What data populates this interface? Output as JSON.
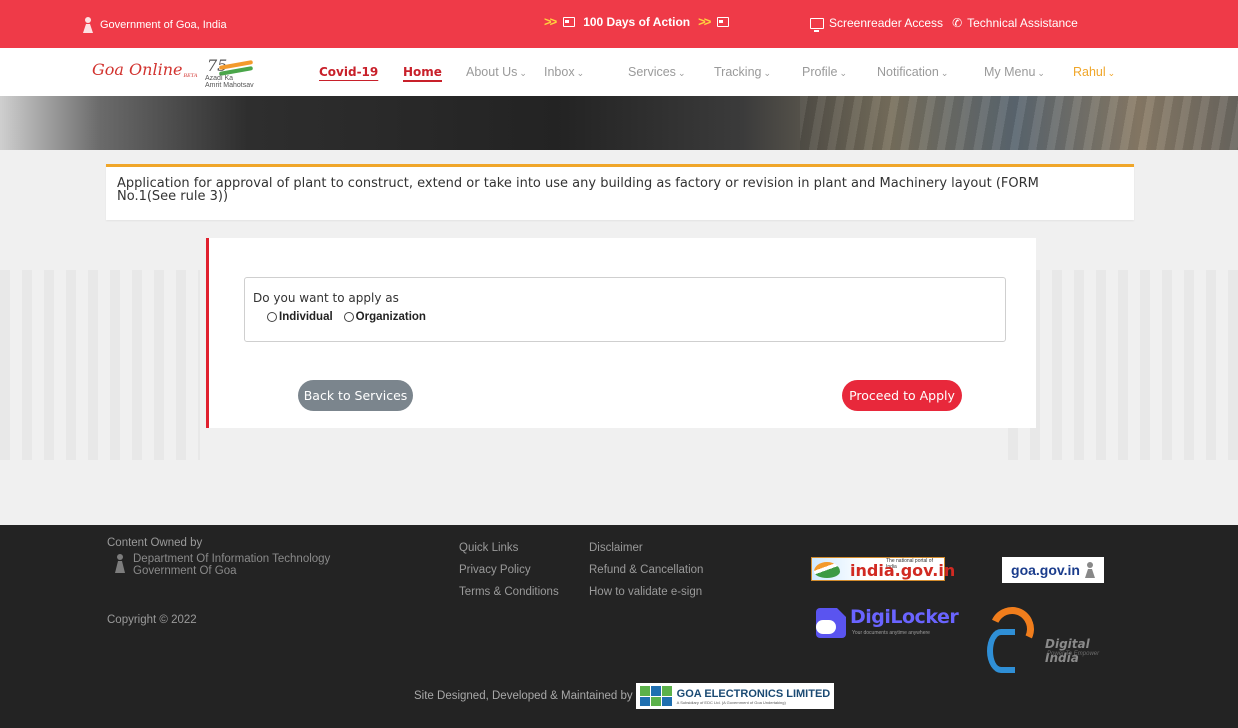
{
  "topbar": {
    "gov_label": "Government of Goa, India",
    "campaign_chevrons": ">>",
    "campaign_label": "100 Days of Action",
    "screenreader_label": "Screenreader Access",
    "tech_label": "Technical Assistance"
  },
  "nav": {
    "brand": "Goa Online",
    "brand_small": "BETA",
    "azadi_top": "Azadi Ka",
    "azadi_bottom": "Amrit Mahotsav",
    "items": [
      {
        "label": "Covid-19"
      },
      {
        "label": "Home"
      },
      {
        "label": "About Us"
      },
      {
        "label": "Inbox"
      },
      {
        "label": "Services"
      },
      {
        "label": "Tracking"
      },
      {
        "label": "Profile"
      },
      {
        "label": "Notification"
      },
      {
        "label": "My Menu"
      },
      {
        "label": "Rahul"
      }
    ]
  },
  "form": {
    "title": "Application for approval of plant to construct, extend or take into use any building as factory or revision in plant and Machinery layout (FORM No.1(See rule 3))",
    "question": "Do you want to apply as",
    "options": [
      "Individual",
      "Organization"
    ],
    "back_label": "Back to Services",
    "proceed_label": "Proceed to Apply"
  },
  "footer": {
    "content_owned": "Content Owned by",
    "dept_line1": "Department Of Information Technology",
    "dept_line2": "Government Of Goa",
    "copyright": "Copyright © 2022",
    "links_col1": [
      "Quick Links",
      "Privacy Policy",
      "Terms & Conditions"
    ],
    "links_col2": [
      "Disclaimer",
      "Refund & Cancellation",
      "How to validate e-sign"
    ],
    "india_gov": "india.gov.in",
    "india_gov_sub": "The national portal of India",
    "goa_gov": "goa.gov.in",
    "digilocker": "DigiLocker",
    "digilocker_tag": "Your documents anytime anywhere",
    "digital_india": "Digital India",
    "digital_india_tag": "Power To Empower",
    "designed_by": "Site Designed, Developed & Maintained by",
    "gel_name": "GOA ELECTRONICS LIMITED",
    "gel_sub": "A Subsidiary of EDC Ltd. (A Government of Goa Undertaking)"
  },
  "colors": {
    "topbar": "#ef3a48",
    "accent_active": "#c8202a",
    "user_menu": "#f0a629",
    "proceed_button": "#e8283b",
    "back_button": "#7b858d",
    "footer_bg": "#232323"
  }
}
